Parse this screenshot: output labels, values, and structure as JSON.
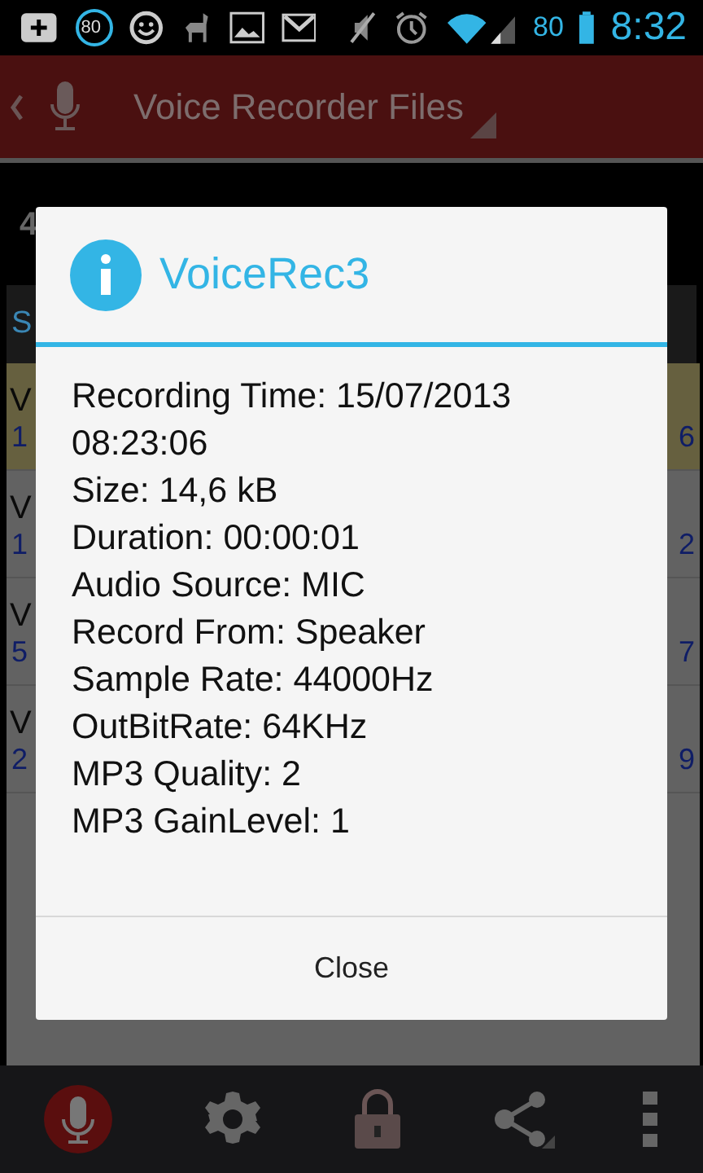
{
  "status_bar": {
    "badge": "80",
    "battery": "80",
    "time": "8:32"
  },
  "action_bar": {
    "title": "Voice Recorder Files"
  },
  "toolbar": {
    "count": "4"
  },
  "section": {
    "label": "S"
  },
  "files": [
    {
      "name": "V",
      "info": "1",
      "size": "6",
      "selected": true
    },
    {
      "name": "V",
      "info": "1",
      "size": "2",
      "selected": false
    },
    {
      "name": "V",
      "info": "5",
      "size": "7",
      "selected": false
    },
    {
      "name": "V",
      "info": "2",
      "size": "9",
      "selected": false
    }
  ],
  "dialog": {
    "title": "VoiceRec3",
    "lines": [
      "Recording Time: 15/07/2013 08:23:06",
      "Size: 14,6 kB",
      "Duration: 00:00:01",
      "Audio Source: MIC",
      "Record From: Speaker",
      "Sample Rate: 44000Hz",
      "OutBitRate: 64KHz",
      "MP3 Quality: 2",
      "MP3 GainLevel: 1"
    ],
    "button": "Close"
  }
}
